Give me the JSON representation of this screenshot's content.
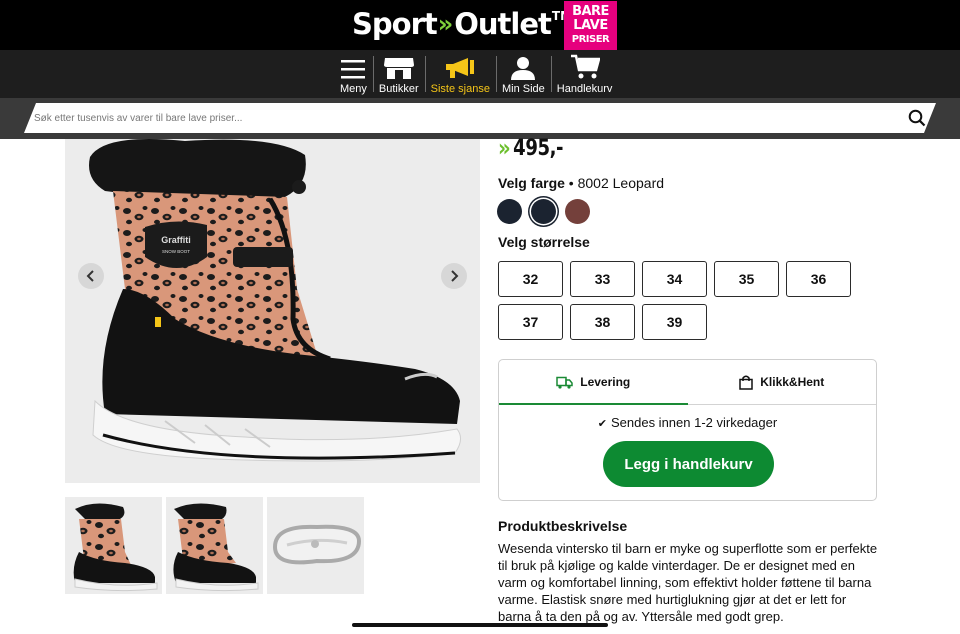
{
  "header": {
    "logo_sport": "Sport",
    "logo_arrows": "»",
    "logo_outlet": "Outlet",
    "logo_tm": "TM",
    "badge_line1": "BARE",
    "badge_line2": "LAVE",
    "badge_line3": "PRISER",
    "accent_green": "#7fd13b",
    "badge_color": "#e6007e"
  },
  "nav": {
    "items": [
      {
        "label": "Meny",
        "icon": "hamburger-icon"
      },
      {
        "label": "Butikker",
        "icon": "store-icon"
      },
      {
        "label": "Siste sjanse",
        "icon": "megaphone-icon",
        "active": true
      },
      {
        "label": "Min Side",
        "icon": "user-icon"
      },
      {
        "label": "Handlekurv",
        "icon": "cart-icon"
      }
    ],
    "active_color": "#f5c518"
  },
  "search": {
    "placeholder": "Søk etter tusenvis av varer til bare lave priser..."
  },
  "product": {
    "price_chevron": "»",
    "price": "495,-",
    "color_key": "Velg farge",
    "color_sep": " • ",
    "color_value": "8002 Leopard",
    "swatches": [
      {
        "color": "#1b2330",
        "selected": false
      },
      {
        "color": "#1b2330",
        "selected": true
      },
      {
        "color": "#74403b",
        "selected": false
      }
    ],
    "size_label": "Velg størrelse",
    "sizes": [
      "32",
      "33",
      "34",
      "35",
      "36",
      "37",
      "38",
      "39"
    ]
  },
  "delivery": {
    "tabs": [
      {
        "label": "Levering",
        "icon": "truck-icon",
        "active": true
      },
      {
        "label": "Klikk&Hent",
        "icon": "bag-icon",
        "active": false
      }
    ],
    "check": "✔",
    "ships_text": "Sendes innen 1-2 virkedager",
    "cart_button": "Legg i handlekurv",
    "cart_color": "#0d8a32"
  },
  "description": {
    "title": "Produktbeskrivelse",
    "text": "Wesenda vintersko til barn er myke og superflotte som er perfekte til bruk på kjølige og kalde vinterdager. De er designet med en varm og komfortabel linning, som effektivt holder føttene til barna varme. Elastisk snøre med hurtiglukning gjør at det er lett for barna å ta den på og av. Yttersåle med godt grep."
  },
  "boot": {
    "badge_text": "Graffiti",
    "badge_sub": "SNOW BOOT"
  }
}
